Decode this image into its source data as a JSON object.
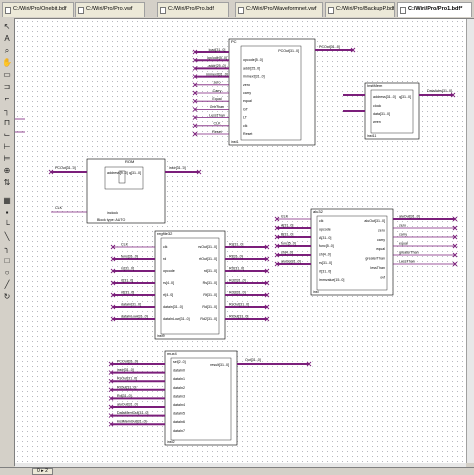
{
  "tabs": [
    {
      "label": "C:/Wiri/Pro/Onebit.bdf",
      "active": false
    },
    {
      "label": "C:/Wiri/Pro/Pro.vwf",
      "active": false
    },
    {
      "label": "C:/Wiri/Pro/Pro.bdf",
      "active": false
    },
    {
      "label": "C:/Wiri/Pro/Waveformnet.vwf",
      "active": false
    },
    {
      "label": "C:/Wiri/Pro/BackupP.bdf",
      "active": false
    },
    {
      "label": "C:/Wiri/Pro/Pro1.bdf*",
      "active": true
    }
  ],
  "toolbar": {
    "icons": [
      "select-icon",
      "text-icon",
      "zoom-icon",
      "hand-icon",
      "symbol-icon",
      "pin-icon",
      "wire-icon",
      "bus-icon",
      "conduit-icon",
      "node-icon",
      "rubberband-icon",
      "partial-line-icon",
      "line-icon",
      "arc-icon",
      "rectangle-icon",
      "oval-icon",
      "circle-icon",
      "rotate-icon",
      "flip-icon",
      "snap-icon"
    ]
  },
  "status": {
    "zoom": "0 ▸ 2"
  },
  "schematic": {
    "blocks": [
      {
        "id": "pc",
        "title": "PC",
        "instance": "inst1",
        "left_ports": [
          "load[31..0]",
          "opcode[5..0]",
          "addr[25..0]",
          "immext[31..0]",
          "zero",
          "Carry",
          "Equal",
          "GrtrThan",
          "LessThan",
          "CLK",
          "Reset"
        ],
        "right_ports": [
          "PCOut[31..0]"
        ],
        "inner_left": [
          "opcode[5..0]",
          "addr[25..0]",
          "immext[31..0]",
          "zero",
          "carry",
          "equal",
          "GT",
          "LT",
          "clk",
          "Reset"
        ],
        "inner_right": [
          "PCOut[31..0]"
        ]
      },
      {
        "id": "instmem",
        "title": "InstMem",
        "instance": "inst11",
        "left_ports": [],
        "right_ports": [
          "DataAdrs[31..0]"
        ],
        "inner_left": [
          "address[31..0]",
          "clock",
          "data[31..0]",
          "wren"
        ],
        "inner_right": [
          "q[31..0]"
        ]
      },
      {
        "id": "rom",
        "title": "ROM",
        "instance": "",
        "left_ports": [
          "PCOut[31..0]",
          "CLK"
        ],
        "right_ports": [
          "instr[31..0]"
        ],
        "inner_left": [
          "address[9..0]",
          "inclock"
        ],
        "inner_right": [
          "q[31..0]"
        ],
        "footer": "Block type: AUTO"
      },
      {
        "id": "regfile",
        "title": "regfile32",
        "instance": "inst9",
        "left_ports": [
          "CLK",
          "func[31..0]",
          "rs[31..0]",
          "rt[31..0]",
          "rd[31..0]",
          "dataIn[31..0]",
          "dataInLow[31..0]"
        ],
        "right_ports": [
          "Rs[31..0]",
          "Rt[31..0]",
          "RD[31..0]",
          "Rd2[31..0]",
          "Rd3[31..0]",
          "RsOut[31..0]",
          "RtOut[31..0]"
        ],
        "inner_left": [
          "clk",
          "rd",
          "opcode",
          "rs[4..0]",
          "rt[4..0]",
          "datain[31..0]",
          "dataInLow[31..0]"
        ],
        "inner_right": [
          "rsOut[31..0]",
          "rtOut[31..0]",
          "rd[31..0]",
          "Rs[31..0]",
          "Rt[31..0]",
          "Rd[31..0]",
          "Rd2[31..0]"
        ]
      },
      {
        "id": "alu",
        "title": "alu32",
        "instance": "inst",
        "left_ports": [
          "CLK",
          "A[31..0]",
          "B[31..0]",
          "func[5..0]",
          "sh[4..0]",
          "aluOp[31..0]"
        ],
        "right_ports": [
          "aluOut[31..0]",
          "zero",
          "carry",
          "equal",
          "greaterThan",
          "LessThan"
        ],
        "inner_left": [
          "clk",
          "opcode",
          "A[31..0]",
          "func[5..0]",
          "sh[4..0]",
          "rs[31..0]",
          "rt[31..0]",
          "immvalue[15..0]"
        ],
        "inner_right": [
          "aluOut[31..0]",
          "zero",
          "carry",
          "equal",
          "greaterThan",
          "lessThan",
          "ovf"
        ]
      },
      {
        "id": "mux",
        "title": "mux4",
        "instance": "inst2",
        "left_ports": [
          "PCOut[31..0]",
          "instr[31..0]",
          "RsOut[31..0]",
          "RtOut[31..0]",
          "Rd[31..0]",
          "aluOut[31..0]",
          "DataMemOut[31..0]",
          "InstMemOut[31..0]"
        ],
        "right_ports": [
          "Out[31..0]"
        ],
        "inner_left": [
          "sel[2..0]",
          "dataIn0",
          "dataIn1",
          "dataIn2",
          "dataIn3",
          "dataIn4",
          "dataIn5",
          "dataIn6",
          "dataIn7"
        ],
        "inner_right": [
          "result[31..0]"
        ]
      }
    ],
    "loose_labels": [
      "CLK",
      "DataAdrs[31..0]"
    ]
  }
}
